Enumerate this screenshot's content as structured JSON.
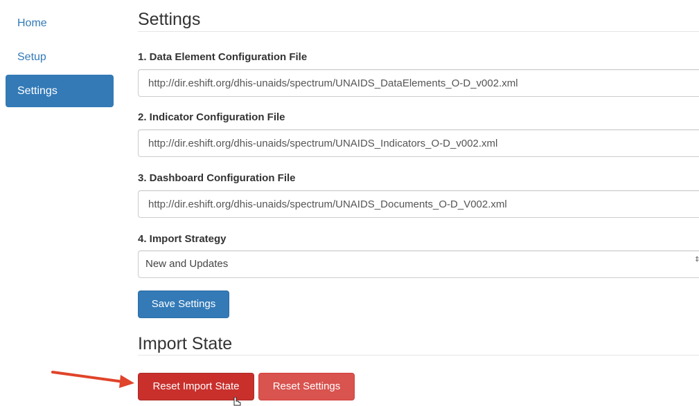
{
  "sidebar": {
    "items": [
      {
        "label": "Home",
        "active": false
      },
      {
        "label": "Setup",
        "active": false
      },
      {
        "label": "Settings",
        "active": true
      }
    ]
  },
  "settings": {
    "title": "Settings",
    "fields": [
      {
        "label": "1. Data Element Configuration File",
        "value": "http://dir.eshift.org/dhis-unaids/spectrum/UNAIDS_DataElements_O-D_v002.xml"
      },
      {
        "label": "2. Indicator Configuration File",
        "value": "http://dir.eshift.org/dhis-unaids/spectrum/UNAIDS_Indicators_O-D_v002.xml"
      },
      {
        "label": "3. Dashboard Configuration File",
        "value": "http://dir.eshift.org/dhis-unaids/spectrum/UNAIDS_Documents_O-D_V002.xml"
      }
    ],
    "import_strategy": {
      "label": "4. Import Strategy",
      "selected": "New and Updates",
      "arrow_glyph": "⇕"
    },
    "save_label": "Save Settings"
  },
  "import_state": {
    "title": "Import State",
    "reset_import_label": "Reset Import State",
    "reset_settings_label": "Reset Settings"
  },
  "colors": {
    "primary": "#337ab7",
    "danger": "#d9534f",
    "danger_active": "#c9302c",
    "annotation_arrow": "#e0442a"
  }
}
